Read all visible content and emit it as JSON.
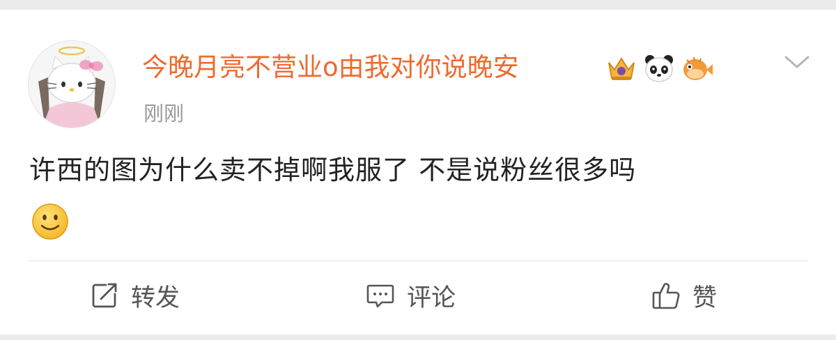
{
  "post": {
    "username": "今晚月亮不营业o由我对你说晚安",
    "timestamp": "刚刚",
    "content": "许西的图为什么卖不掉啊我服了 不是说粉丝很多吗",
    "content_emoji": "smile-emoji"
  },
  "badges": [
    "crown-badge-icon",
    "panda-icon",
    "pufferfish-icon"
  ],
  "actions": {
    "repost_label": "转发",
    "comment_label": "评论",
    "like_label": "赞"
  },
  "colors": {
    "username": "#ee6a2e",
    "text": "#222222",
    "meta": "#9a9a9a",
    "action": "#555555"
  }
}
